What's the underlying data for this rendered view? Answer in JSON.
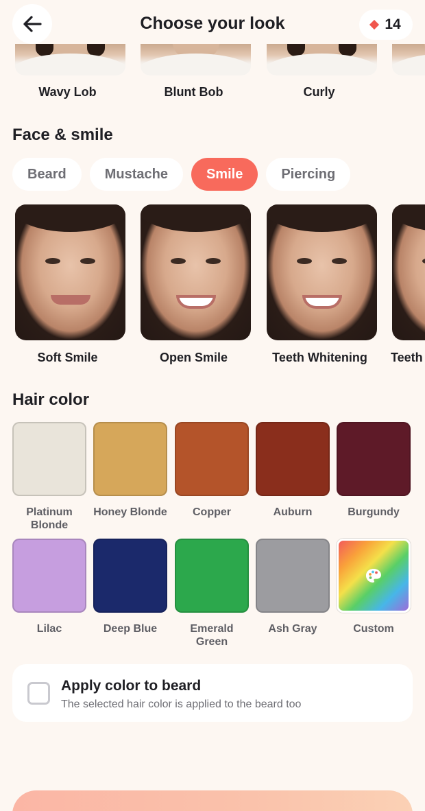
{
  "header": {
    "title": "Choose your look",
    "gem_count": "14",
    "back_icon": "arrow-left-icon",
    "gem_icon": "diamond-icon",
    "accent": "#f0564d"
  },
  "hair_styles": [
    {
      "label": "Wavy Lob"
    },
    {
      "label": "Blunt Bob"
    },
    {
      "label": "Curly"
    },
    {
      "label": ""
    }
  ],
  "face_section": {
    "title": "Face & smile",
    "tabs": [
      {
        "label": "Beard",
        "active": false
      },
      {
        "label": "Mustache",
        "active": false
      },
      {
        "label": "Smile",
        "active": true
      },
      {
        "label": "Piercing",
        "active": false
      }
    ],
    "active_color": "#f86a5c",
    "items": [
      {
        "label": "Soft Smile"
      },
      {
        "label": "Open Smile"
      },
      {
        "label": "Teeth Whitening"
      },
      {
        "label": "Teeth"
      }
    ]
  },
  "hair_color": {
    "title": "Hair color",
    "colors": [
      {
        "label": "Platinum Blonde",
        "hex": "#e9e4da"
      },
      {
        "label": "Honey Blonde",
        "hex": "#d6a75a"
      },
      {
        "label": "Copper",
        "hex": "#b4542a"
      },
      {
        "label": "Auburn",
        "hex": "#8a2e1c"
      },
      {
        "label": "Burgundy",
        "hex": "#5e1a28"
      },
      {
        "label": "Lilac",
        "hex": "#c69edf"
      },
      {
        "label": "Deep Blue",
        "hex": "#1b296b"
      },
      {
        "label": "Emerald Green",
        "hex": "#2ca84c"
      },
      {
        "label": "Ash Gray",
        "hex": "#9c9ca0"
      },
      {
        "label": "Custom",
        "hex": "rainbow",
        "icon": "palette-icon"
      }
    ]
  },
  "beard_option": {
    "title": "Apply color to beard",
    "subtitle": "The selected hair color is applied to the beard too",
    "checked": false
  }
}
